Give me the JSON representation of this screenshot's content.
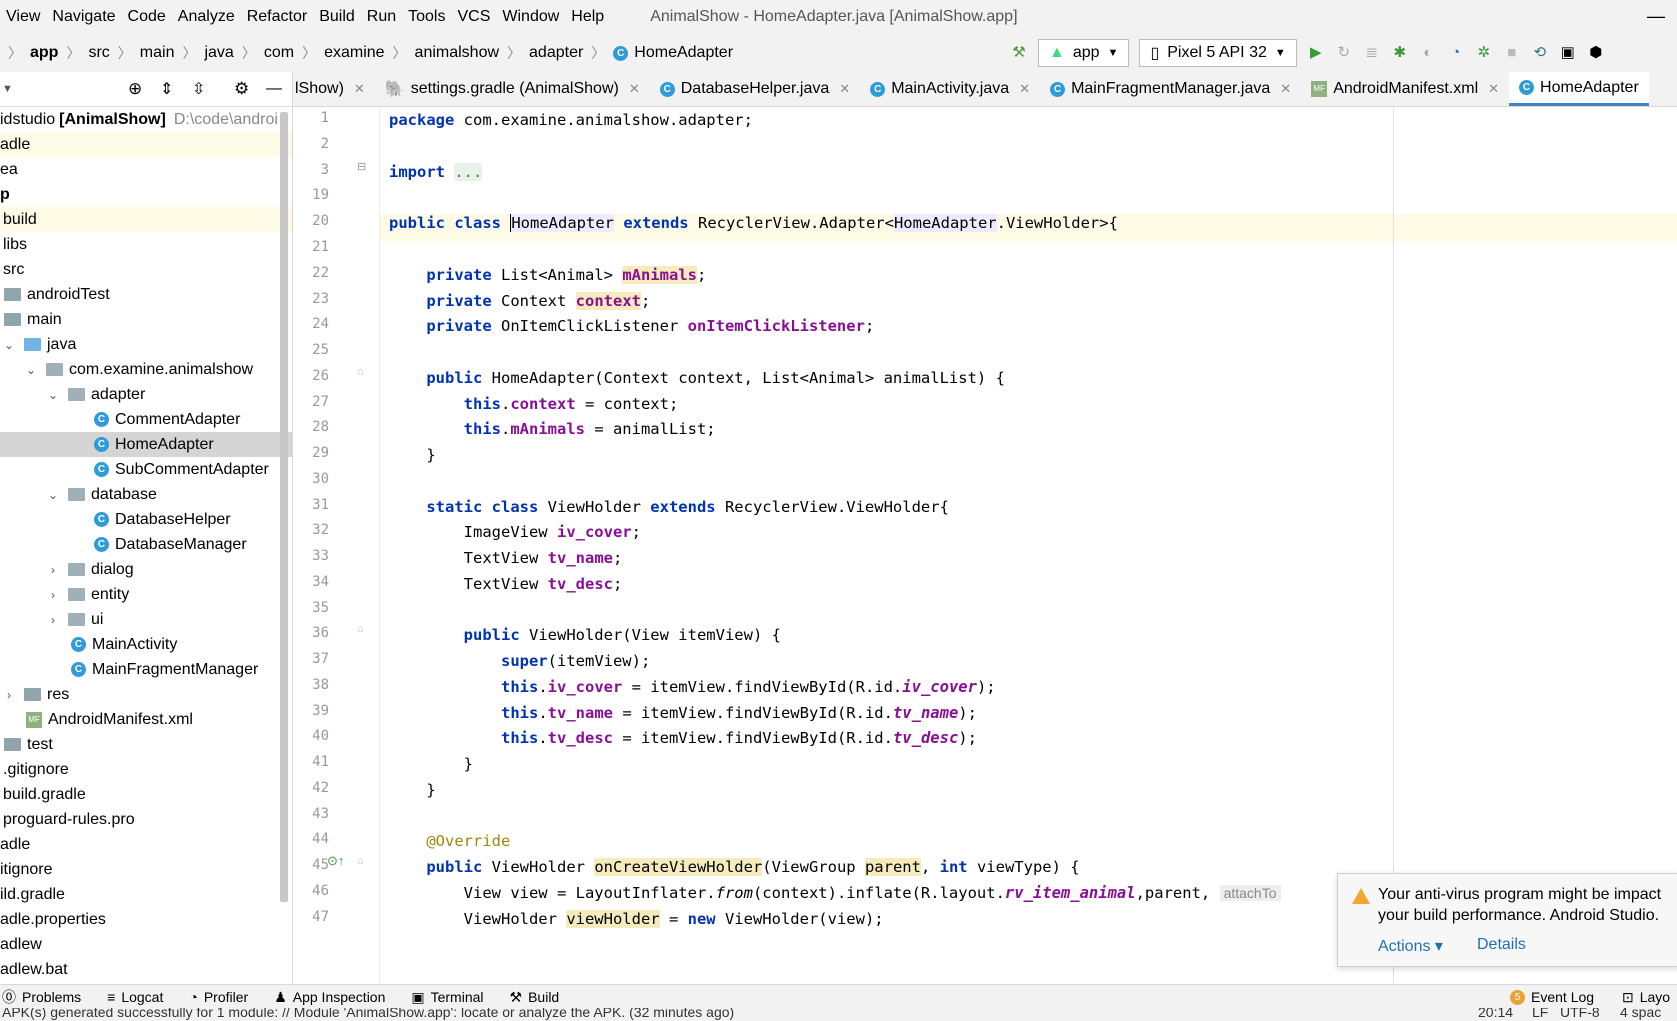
{
  "window": {
    "title": "AnimalShow - HomeAdapter.java [AnimalShow.app]"
  },
  "menu": [
    "View",
    "Navigate",
    "Code",
    "Analyze",
    "Refactor",
    "Build",
    "Run",
    "Tools",
    "VCS",
    "Window",
    "Help"
  ],
  "breadcrumb": [
    "app",
    "src",
    "main",
    "java",
    "com",
    "examine",
    "animalshow",
    "adapter",
    "HomeAdapter"
  ],
  "toolbar": {
    "run_config": "app",
    "device": "Pixel 5 API 32"
  },
  "project_tree": [
    {
      "label": "idstudio",
      "bold": "[AnimalShow]",
      "path": "D:\\code\\androi"
    },
    {
      "label": "adle"
    },
    {
      "label": "ea"
    },
    {
      "label": "p"
    },
    {
      "label": "build"
    },
    {
      "label": "libs"
    },
    {
      "label": "src"
    },
    {
      "label": "androidTest"
    },
    {
      "label": "main"
    },
    {
      "label": "java"
    },
    {
      "label": "com.examine.animalshow"
    },
    {
      "label": "adapter"
    },
    {
      "label": "CommentAdapter"
    },
    {
      "label": "HomeAdapter"
    },
    {
      "label": "SubCommentAdapter"
    },
    {
      "label": "database"
    },
    {
      "label": "DatabaseHelper"
    },
    {
      "label": "DatabaseManager"
    },
    {
      "label": "dialog"
    },
    {
      "label": "entity"
    },
    {
      "label": "ui"
    },
    {
      "label": "MainActivity"
    },
    {
      "label": "MainFragmentManager"
    },
    {
      "label": "res"
    },
    {
      "label": "AndroidManifest.xml"
    },
    {
      "label": "test"
    },
    {
      "label": ".gitignore"
    },
    {
      "label": "build.gradle"
    },
    {
      "label": "proguard-rules.pro"
    },
    {
      "label": "adle"
    },
    {
      "label": "itignore"
    },
    {
      "label": "ild.gradle"
    },
    {
      "label": "adle.properties"
    },
    {
      "label": "adlew"
    },
    {
      "label": "adlew.bat"
    }
  ],
  "tabs": [
    "lShow)",
    "settings.gradle (AnimalShow)",
    "DatabaseHelper.java",
    "MainActivity.java",
    "MainFragmentManager.java",
    "AndroidManifest.xml",
    "HomeAdapter"
  ],
  "code": {
    "line_numbers": [
      "1",
      "2",
      "3",
      "19",
      "20",
      "21",
      "22",
      "23",
      "24",
      "25",
      "26",
      "27",
      "28",
      "29",
      "30",
      "31",
      "32",
      "33",
      "34",
      "35",
      "36",
      "37",
      "38",
      "39",
      "40",
      "41",
      "42",
      "43",
      "44",
      "45",
      "46",
      "47"
    ],
    "l1a": "package",
    "l1b": " com.examine.animalshow.adapter;",
    "l3a": "import",
    "l3b": "...",
    "l20a": "public class ",
    "l20b": "HomeAdapter",
    "l20c": " extends ",
    "l20d": "RecyclerView.Adapter<",
    "l20e": "HomeAdapter",
    "l20f": ".ViewHolder>{",
    "l22a": "private",
    "l22b": " List<Animal> ",
    "l22c": "mAnimals",
    "l22d": ";",
    "l23a": "private",
    "l23b": " Context ",
    "l23c": "context",
    "l23d": ";",
    "l24a": "private",
    "l24b": " OnItemClickListener ",
    "l24c": "onItemClickListener",
    "l24d": ";",
    "l26a": "public",
    "l26b": " HomeAdapter(Context context, List<Animal> animalList) {",
    "l27a": "this",
    "l27b": ".",
    "l27c": "context",
    "l27d": " = context;",
    "l28a": "this",
    "l28b": ".",
    "l28c": "mAnimals",
    "l28d": " = animalList;",
    "l29": "}",
    "l31a": "static class",
    "l31b": " ViewHolder ",
    "l31c": "extends",
    "l31d": " RecyclerView.ViewHolder{",
    "l32a": "ImageView ",
    "l32b": "iv_cover",
    "l32c": ";",
    "l33a": "TextView ",
    "l33b": "tv_name",
    "l33c": ";",
    "l34a": "TextView ",
    "l34b": "tv_desc",
    "l34c": ";",
    "l36a": "public",
    "l36b": " ViewHolder(View itemView) {",
    "l37a": "super",
    "l37b": "(itemView);",
    "l38a": "this",
    "l38b": ".",
    "l38c": "iv_cover",
    "l38d": " = itemView.findViewById(R.id.",
    "l38e": "iv_cover",
    "l38f": ");",
    "l39a": "this",
    "l39b": ".",
    "l39c": "tv_name",
    "l39d": " = itemView.findViewById(R.id.",
    "l39e": "tv_name",
    "l39f": ");",
    "l40a": "this",
    "l40b": ".",
    "l40c": "tv_desc",
    "l40d": " = itemView.findViewById(R.id.",
    "l40e": "tv_desc",
    "l40f": ");",
    "l41": "}",
    "l42": "}",
    "l44": "@Override",
    "l45a": "public",
    "l45b": " ViewHolder ",
    "l45c": "onCreateViewHolder",
    "l45d": "(ViewGroup ",
    "l45e": "parent",
    "l45f": ", ",
    "l45g": "int",
    "l45h": " viewType) {",
    "l46a": "View view = LayoutInflater.",
    "l46b": "from",
    "l46c": "(context).inflate(R.layout.",
    "l46d": "rv_item_animal",
    "l46e": ",parent, ",
    "l46f": "attachTo",
    "l47a": "ViewHolder ",
    "l47b": "viewHolder",
    "l47c": " = ",
    "l47d": "new",
    "l47e": " ViewHolder(view);"
  },
  "notification": {
    "line1": "Your anti-virus program might be impact",
    "line2": "your build performance. Android Studio.",
    "actions": "Actions ▾",
    "details": "Details"
  },
  "bottom_tools": [
    "Problems",
    "Logcat",
    "Profiler",
    "App Inspection",
    "Terminal",
    "Build"
  ],
  "event_log": {
    "count": "5",
    "label": "Event Log"
  },
  "layout_inspector": "Layo",
  "status": {
    "message": "APK(s) generated successfully for 1 module: // Module 'AnimalShow.app': locate or analyze the APK. (32 minutes ago)",
    "position": "20:14",
    "line_sep": "LF",
    "encoding": "UTF-8",
    "indent": "4 spac"
  },
  "colors": {
    "keyword": "#0033b3",
    "field": "#871094",
    "annotation": "#9e880d",
    "current_line": "#fdfbe6",
    "tab_active": "#4083c9"
  }
}
